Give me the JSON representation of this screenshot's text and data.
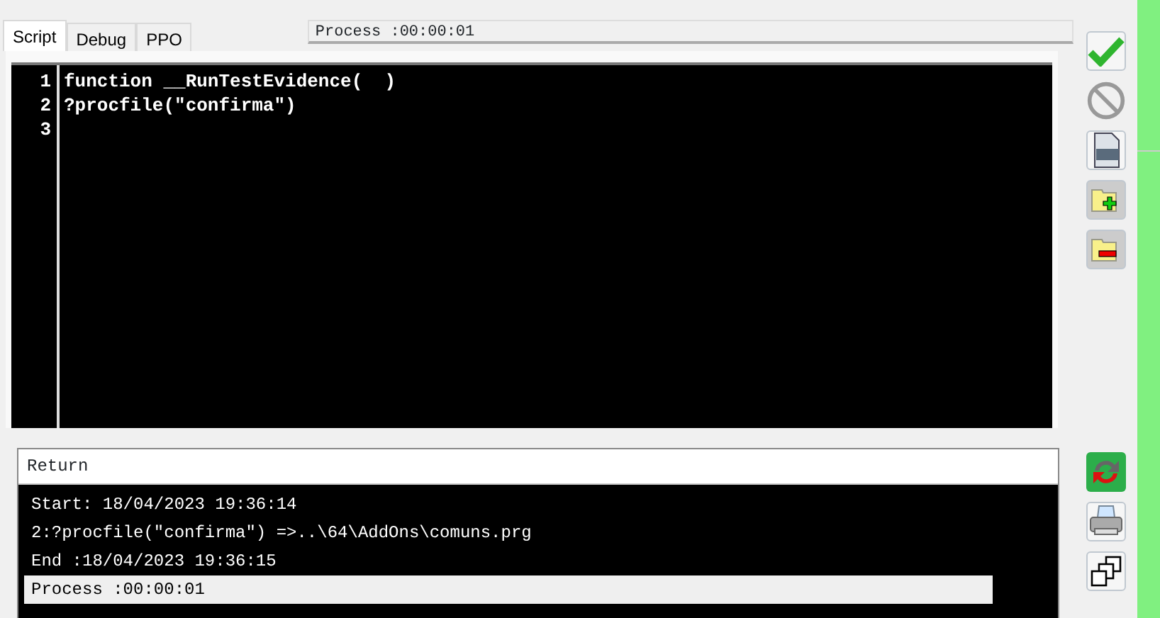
{
  "tabs": [
    {
      "label": "Script",
      "selected": true
    },
    {
      "label": "Debug",
      "selected": false
    },
    {
      "label": "PPO",
      "selected": false
    }
  ],
  "process_field": {
    "value": "Process :00:00:01"
  },
  "editor": {
    "lines": [
      {
        "number": "1",
        "code": "function __RunTestEvidence(  )"
      },
      {
        "number": "2",
        "code": "?procfile(\"confirma\")"
      },
      {
        "number": "3"
      }
    ]
  },
  "output": {
    "header": "Return",
    "lines": [
      {
        "text": "Start: 18/04/2023 19:36:14",
        "selected": false
      },
      {
        "text": "2:?procfile(\"confirma\") =>..\\64\\AddOns\\comuns.prg",
        "selected": false
      },
      {
        "text": "End :18/04/2023 19:36:15",
        "selected": false
      },
      {
        "text": "Process :00:00:01",
        "selected": true
      }
    ]
  }
}
